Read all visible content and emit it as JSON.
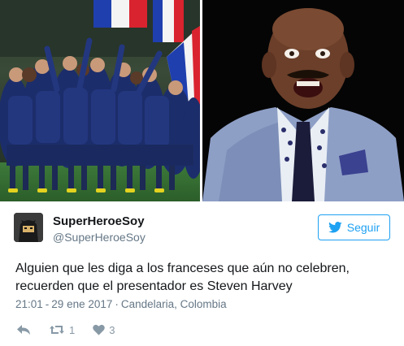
{
  "tweet": {
    "display_name": "SuperHeroeSoy",
    "handle": "@SuperHeroeSoy",
    "follow_label": "Seguir",
    "text_lines": [
      "Alguien que les diga a los franceses que aún no celebren,",
      "recuerden que el presentador es Steven Harvey"
    ],
    "time": "21:01",
    "date": "29 ene 2017",
    "location": "Candelaria, Colombia",
    "retweet_count": "1",
    "like_count": "3"
  },
  "icons": {
    "reply": "reply-icon",
    "retweet": "retweet-icon",
    "like": "heart-icon",
    "follow": "twitter-bird-icon"
  },
  "colors": {
    "accent": "#1da1f2",
    "text": "#14171a",
    "muted": "#657786",
    "action": "#8899a6"
  }
}
